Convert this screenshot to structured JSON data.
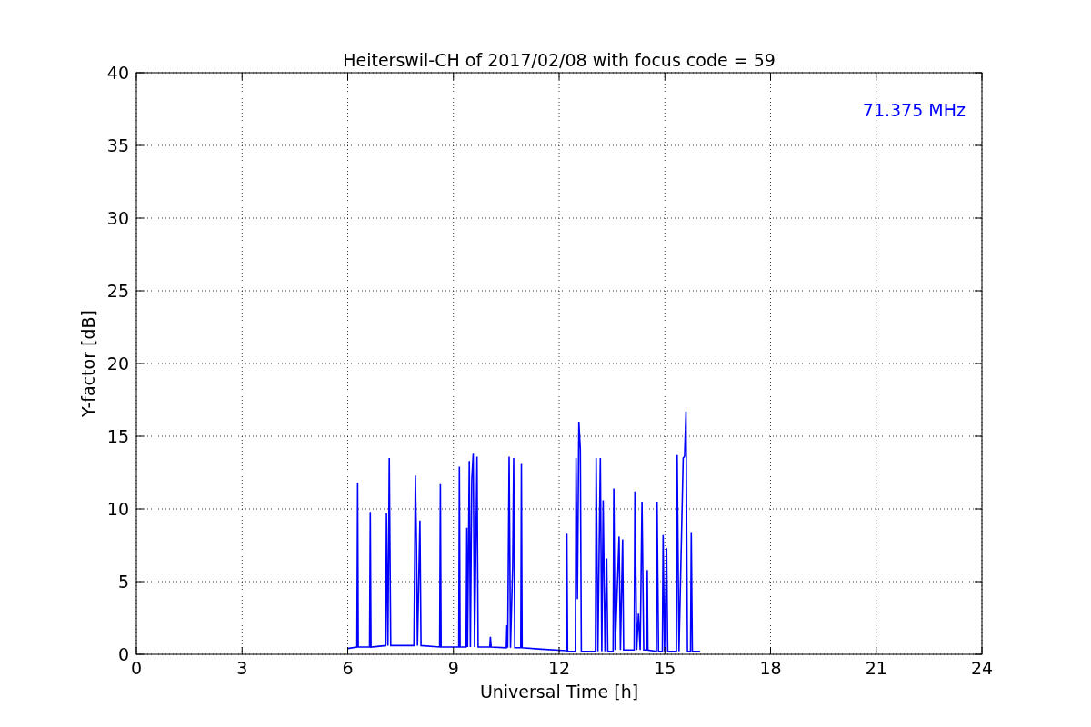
{
  "figure": {
    "chart_data": {
      "type": "line",
      "title": "Heiterswil-CH of 2017/02/08 with focus code = 59",
      "xlabel": "Universal Time [h]",
      "ylabel": "Y-factor [dB]",
      "xlim": [
        0,
        24
      ],
      "ylim": [
        0,
        40
      ],
      "xticks": [
        0,
        3,
        6,
        9,
        12,
        15,
        18,
        21,
        24
      ],
      "yticks": [
        0,
        5,
        10,
        15,
        20,
        25,
        30,
        35,
        40
      ],
      "x": [
        6.0,
        6.26,
        6.28,
        6.3,
        6.62,
        6.64,
        6.66,
        7.08,
        7.1,
        7.14,
        7.18,
        7.22,
        7.88,
        7.92,
        7.95,
        7.98,
        8.05,
        8.08,
        8.61,
        8.63,
        8.65,
        9.15,
        9.17,
        9.19,
        9.36,
        9.38,
        9.4,
        9.45,
        9.48,
        9.52,
        9.56,
        9.6,
        9.67,
        9.7,
        10.03,
        10.05,
        10.07,
        10.5,
        10.52,
        10.54,
        10.58,
        10.62,
        10.68,
        10.71,
        10.74,
        10.91,
        10.93,
        10.95,
        11.5,
        12.2,
        12.22,
        12.24,
        12.46,
        12.48,
        12.52,
        12.56,
        12.6,
        12.63,
        13.03,
        13.05,
        13.1,
        13.17,
        13.21,
        13.25,
        13.3,
        13.35,
        13.38,
        13.53,
        13.55,
        13.59,
        13.7,
        13.74,
        13.8,
        13.83,
        14.13,
        14.15,
        14.2,
        14.25,
        14.3,
        14.35,
        14.4,
        14.48,
        14.5,
        14.52,
        14.76,
        14.78,
        14.82,
        14.93,
        14.95,
        14.99,
        15.05,
        15.08,
        15.33,
        15.35,
        15.4,
        15.52,
        15.56,
        15.6,
        15.64,
        15.73,
        15.75,
        15.78,
        16.0
      ],
      "series": [
        {
          "name": "71.375 MHz",
          "color": "#0000ff",
          "values": [
            0.4,
            0.5,
            11.8,
            0.5,
            0.5,
            9.8,
            0.5,
            0.6,
            9.7,
            0.6,
            13.5,
            0.6,
            0.6,
            12.3,
            7.7,
            0.6,
            9.2,
            0.6,
            0.5,
            11.7,
            0.5,
            0.5,
            12.9,
            0.5,
            0.5,
            8.7,
            0.5,
            13.3,
            0.5,
            12.0,
            13.8,
            0.5,
            13.6,
            0.5,
            0.5,
            1.2,
            0.5,
            0.45,
            2.0,
            0.45,
            13.6,
            0.45,
            6.1,
            13.5,
            0.45,
            0.45,
            13.1,
            0.45,
            0.35,
            0.25,
            8.3,
            0.2,
            0.2,
            13.5,
            3.8,
            16.0,
            14.1,
            0.2,
            0.2,
            13.5,
            0.2,
            13.5,
            0.2,
            10.6,
            0.2,
            6.6,
            0.2,
            0.2,
            11.4,
            0.3,
            8.1,
            0.3,
            7.9,
            0.3,
            0.3,
            11.2,
            0.3,
            2.8,
            0.3,
            10.5,
            0.3,
            0.3,
            5.8,
            0.3,
            0.2,
            10.5,
            0.2,
            0.2,
            8.2,
            0.2,
            7.3,
            0.2,
            0.2,
            13.7,
            0.2,
            13.5,
            13.6,
            16.7,
            0.2,
            0.2,
            8.4,
            0.2,
            0.2
          ]
        }
      ],
      "grid": true
    }
  }
}
